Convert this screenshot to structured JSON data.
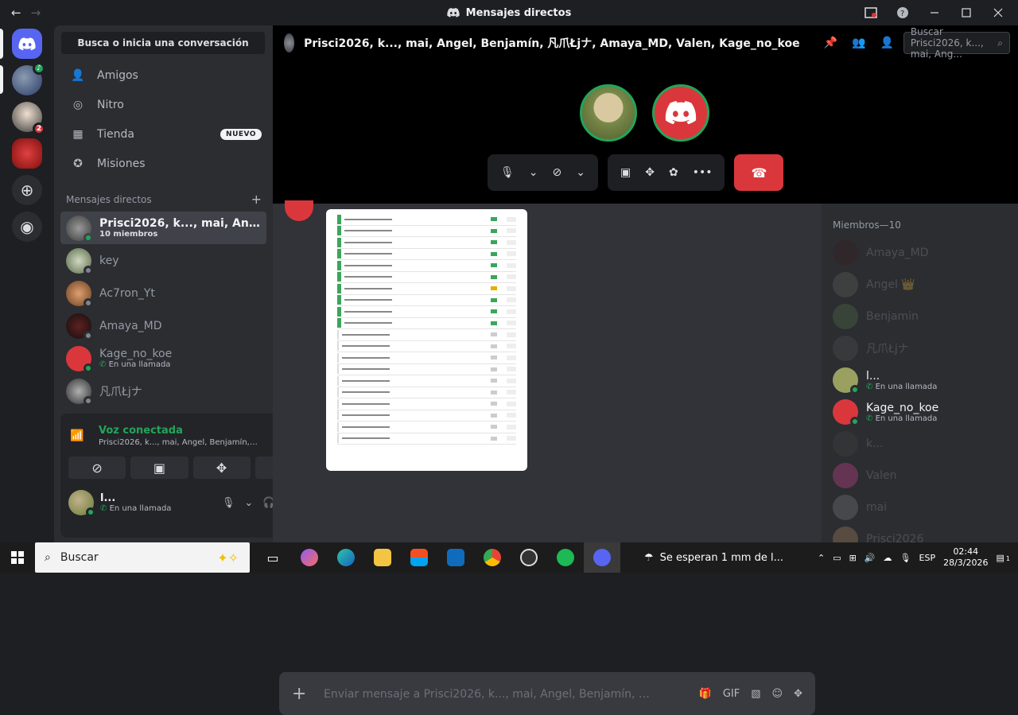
{
  "window": {
    "title": "Mensajes directos",
    "nav_back": "←",
    "nav_forward": "→"
  },
  "sidebar": {
    "search_label": "Busca o inicia una conversación",
    "nav": [
      {
        "label": "Amigos",
        "icon": "friends-icon"
      },
      {
        "label": "Nitro",
        "icon": "nitro-icon"
      },
      {
        "label": "Tienda",
        "icon": "shop-icon",
        "badge": "NUEVO"
      },
      {
        "label": "Misiones",
        "icon": "quests-icon"
      }
    ],
    "dm_header": "Mensajes directos",
    "dms": [
      {
        "name": "Prisci2026, k..., mai, Angel, Be...",
        "sub": "10 miembros",
        "active": true
      },
      {
        "name": "key",
        "sub": ""
      },
      {
        "name": "Ac7ron_Yt",
        "sub": ""
      },
      {
        "name": "Amaya_MD",
        "sub": ""
      },
      {
        "name": "Kage_no_koe",
        "sub": "En una llamada"
      },
      {
        "name": "凡爪Łjナ",
        "sub": ""
      }
    ]
  },
  "servers": {
    "badge_count": "2"
  },
  "voice": {
    "status": "Voz conectada",
    "channel": "Prisci2026, k..., mai, Angel, Benjamín, ..."
  },
  "user": {
    "name": "l...",
    "status": "En una llamada"
  },
  "channel": {
    "name": "Prisci2026, k..., mai, Angel, Benjamín, 凡爪Łjナ, Amaya_MD, Valen, Kage_no_koe",
    "search_placeholder": "Buscar Prisci2026, k..., mai, Ang..."
  },
  "composer": {
    "placeholder": "Enviar mensaje a Prisci2026, k..., mai, Angel, Benjamín, 凡爪Łjナ..."
  },
  "members": {
    "header": "Miembros—10",
    "list": [
      {
        "name": "Amaya_MD",
        "sub": "",
        "offline": true,
        "color": "#3a1a1a"
      },
      {
        "name": "Angel 👑",
        "sub": "",
        "offline": true,
        "color": "#6a6a60"
      },
      {
        "name": "Benjamin",
        "sub": "",
        "offline": true,
        "color": "#5a7a4a"
      },
      {
        "name": "凡爪Łjナ",
        "sub": "",
        "offline": true,
        "color": "#555"
      },
      {
        "name": "l...",
        "sub": "En una llamada",
        "offline": false,
        "color": "#9aa060"
      },
      {
        "name": "Kage_no_koe",
        "sub": "En una llamada",
        "offline": false,
        "color": "#da373c"
      },
      {
        "name": "k...",
        "sub": "",
        "offline": true,
        "color": "#444"
      },
      {
        "name": "Valen",
        "sub": "",
        "offline": true,
        "color": "#eb459e"
      },
      {
        "name": "mai",
        "sub": "",
        "offline": true,
        "color": "#888"
      },
      {
        "name": "Prisci2026",
        "sub": "",
        "offline": true,
        "color": "#c09060"
      }
    ]
  },
  "taskbar": {
    "search": "Buscar",
    "weather": "Se esperan 1 mm de l...",
    "lang": "ESP",
    "time": "02:44",
    "date": "28/3/2026",
    "notif": "1"
  }
}
